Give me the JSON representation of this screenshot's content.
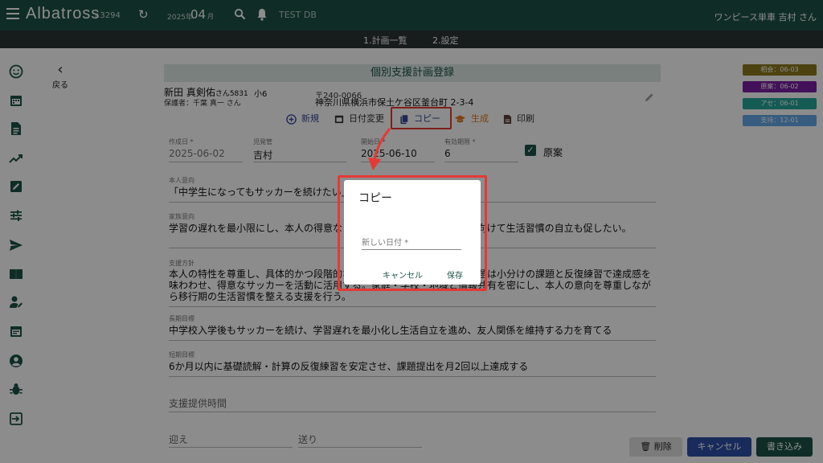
{
  "header": {
    "brand": "Albatross",
    "version": "r.3294",
    "year": "2025年",
    "month": "04",
    "month_unit": "月",
    "db": "TEST DB",
    "user": "ワンピース単車 吉村 さん"
  },
  "subnav": {
    "items": [
      "1.計画一覧",
      "2.設定"
    ]
  },
  "back": {
    "label": "戻る"
  },
  "form": {
    "title": "個別支援計画登録",
    "patient_name": "新田 真剣佑",
    "patient_suffix": "さん5831",
    "grade": "小6",
    "guardian": "保護者：千葉 真一 さん",
    "zip": "〒240-0066",
    "address": "神奈川県横浜市保土ケ谷区釜台町 2-3-4"
  },
  "actions": {
    "new": "新規",
    "change_date": "日付変更",
    "copy": "コピー",
    "generate": "生成",
    "print": "印刷"
  },
  "fields": {
    "created_label": "作成日 *",
    "created_value": "2025-06-02",
    "manager_label": "児発管",
    "manager_value": "吉村",
    "start_label": "開始日 *",
    "start_value": "2025-06-10",
    "valid_label": "有効期限 *",
    "valid_value": "6",
    "draft_label": "原案",
    "intent_self_label": "本人意向",
    "intent_self_value": "「中学生になってもサッカーを続けたい」",
    "intent_family_label": "家族意向",
    "intent_family_value": "学習の遅れを最小限にし、本人の得意なことを伸ばしてほしい。進学に向けて生活習慣の自立も促したい。",
    "policy_label": "支援方針",
    "policy_value": "本人の特性を尊重し、具体的かつ段階的な課題提示で長文読解・算数課題は小分けの課題と反復練習で達成感を味わわせ、得意なサッカーを活動に活用する。家庭・学校・地域と情報共有を密にし、本人の意向を尊重しながら移行期の生活習慣を整える支援を行う。",
    "long_goal_label": "長期目標",
    "long_goal_value": "中学校入学後もサッカーを続け、学習遅れを最小化し生活自立を進め、友人関係を維持する力を育てる",
    "short_goal_label": "短期目標",
    "short_goal_value": "6か月以内に基礎読解・計算の反復練習を安定させ、課題提出を月2回以上達成する",
    "service_time_placeholder": "支援提供時間",
    "pickup_placeholder": "迎え",
    "dropoff_placeholder": "送り"
  },
  "badges": [
    {
      "label": "相会：06-03",
      "color": "#8c7a1e"
    },
    {
      "label": "原案：06-02",
      "color": "#7b1fa2"
    },
    {
      "label": "アセ：06-01",
      "color": "#26a69a"
    },
    {
      "label": "支持：12-01",
      "color": "#64a8e8"
    }
  ],
  "footer": {
    "delete": "削除",
    "cancel": "キャンセル",
    "save": "書き込み"
  },
  "dialog": {
    "title": "コピー",
    "input_placeholder": "新しい日付 *",
    "cancel": "キャンセル",
    "save": "保存"
  },
  "colors": {
    "primary": "#1d5246",
    "highlight": "#e53935"
  }
}
